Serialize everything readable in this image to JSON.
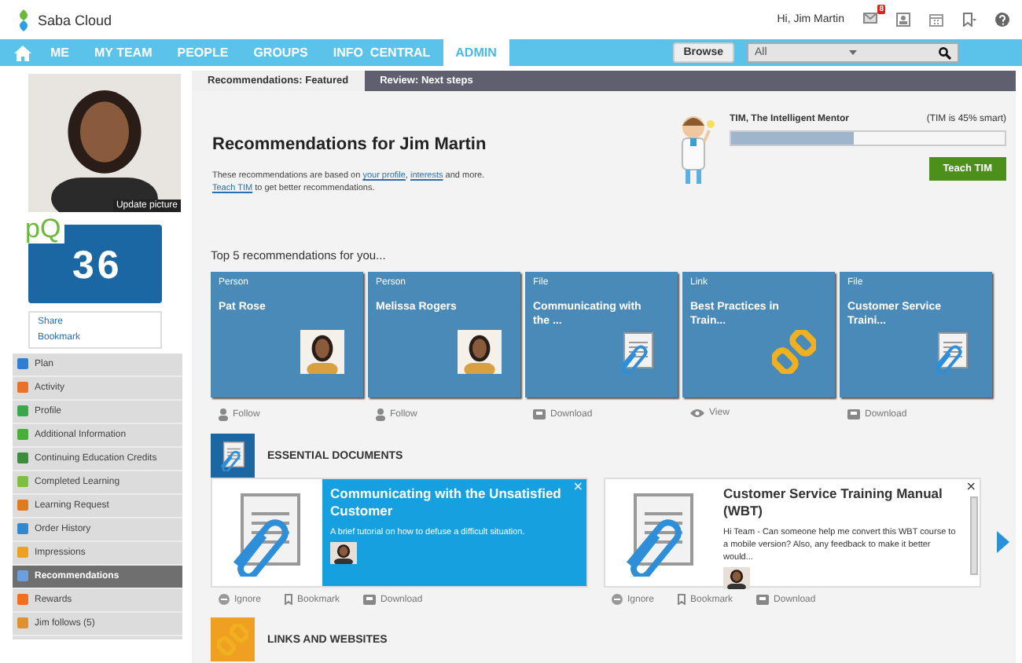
{
  "header": {
    "logo": "Saba Cloud",
    "user": "Hi, Jim Martin",
    "mail_badge": "8"
  },
  "nav": {
    "items": [
      {
        "label": "ME",
        "selected": false
      },
      {
        "label": "MY TEAM",
        "selected": false
      },
      {
        "label": "PEOPLE",
        "selected": false
      },
      {
        "label": "GROUPS",
        "selected": false
      },
      {
        "label": "INFO  CENTRAL",
        "selected": false
      },
      {
        "label": "ADMIN",
        "selected": true
      }
    ],
    "browse": "Browse",
    "search_scope": "All"
  },
  "sidebar": {
    "photo_caption": "Update picture",
    "pq_logo": "pQ",
    "pq_score": "36",
    "links": [
      "Share",
      "Bookmark"
    ],
    "menu": [
      {
        "label": "Plan",
        "color": "#2f7fd0",
        "selected": false
      },
      {
        "label": "Activity",
        "color": "#e8722a",
        "selected": false
      },
      {
        "label": "Profile",
        "color": "#3aa84a",
        "selected": false
      },
      {
        "label": "Additional Information",
        "color": "#45b035",
        "selected": false
      },
      {
        "label": "Continuing Education Credits",
        "color": "#3d8b3d",
        "selected": false
      },
      {
        "label": "Completed Learning",
        "color": "#7fbf3f",
        "selected": false
      },
      {
        "label": "Learning Request",
        "color": "#e07a20",
        "selected": false
      },
      {
        "label": "Order History",
        "color": "#2f88d0",
        "selected": false
      },
      {
        "label": "Impressions",
        "color": "#f0a020",
        "selected": false
      },
      {
        "label": "Recommendations",
        "color": "#6aa0e0",
        "selected": true
      },
      {
        "label": "Rewards",
        "color": "#f07020",
        "selected": false
      },
      {
        "label": "Jim follows (5)",
        "color": "#e09030",
        "selected": false
      }
    ]
  },
  "tabs": [
    {
      "label": "Recommendations: Featured",
      "selected": true
    },
    {
      "label": "Review: Next steps",
      "selected": false
    }
  ],
  "intro": {
    "title": "Recommendations for Jim Martin",
    "lines": [
      [
        {
          "text": "These recommendations are based on ",
          "link": false
        },
        {
          "text": "your profile",
          "link": true
        },
        {
          "text": ", ",
          "link": false
        },
        {
          "text": "interests",
          "link": true
        },
        {
          "text": " and more.",
          "link": false
        }
      ],
      [
        {
          "text": "Teach TIM",
          "link": true
        },
        {
          "text": " to get better recommendations.",
          "link": false
        }
      ]
    ]
  },
  "mentor": {
    "name": "TIM, The Intelligent Mentor",
    "smartness": "(TIM is 45% smart)",
    "level": 0.45,
    "button": "Teach TIM"
  },
  "top_heading": "Top 5 recommendations for you...",
  "cards": [
    {
      "type": "Person",
      "title": "Pat Rose",
      "kind": "person",
      "action": {
        "label": "Follow",
        "kind": "follow"
      }
    },
    {
      "type": "Person",
      "title": "Melissa Rogers",
      "kind": "person",
      "action": {
        "label": "Follow",
        "kind": "follow"
      }
    },
    {
      "type": "File",
      "title": "Communicating with the ...",
      "kind": "file",
      "action": {
        "label": "Download",
        "kind": "download"
      }
    },
    {
      "type": "Link",
      "title": "Best Practices in Train...",
      "kind": "link",
      "action": {
        "label": "View",
        "kind": "view"
      }
    },
    {
      "type": "File",
      "title": "Customer Service Traini...",
      "kind": "file",
      "action": {
        "label": "Download",
        "kind": "download"
      }
    }
  ],
  "sections": [
    {
      "title": "ESSENTIAL DOCUMENTS",
      "kind": "file",
      "docs": [
        {
          "title": "Communicating with the Unsatisfied Customer",
          "text": "A brief tutorial on how to defuse a difficult situation.",
          "selected": true,
          "close": "×",
          "actions": [
            "Ignore",
            "Bookmark",
            "Download"
          ]
        },
        {
          "title": "Customer Service Training Manual (WBT)",
          "text": "Hi Team - Can someone help me convert this WBT course to a mobile version? Also, any feedback to make it better would...",
          "selected": false,
          "close": "×",
          "actions": [
            "Ignore",
            "Bookmark",
            "Download"
          ]
        }
      ]
    },
    {
      "title": "LINKS AND WEBSITES",
      "kind": "link"
    }
  ]
}
